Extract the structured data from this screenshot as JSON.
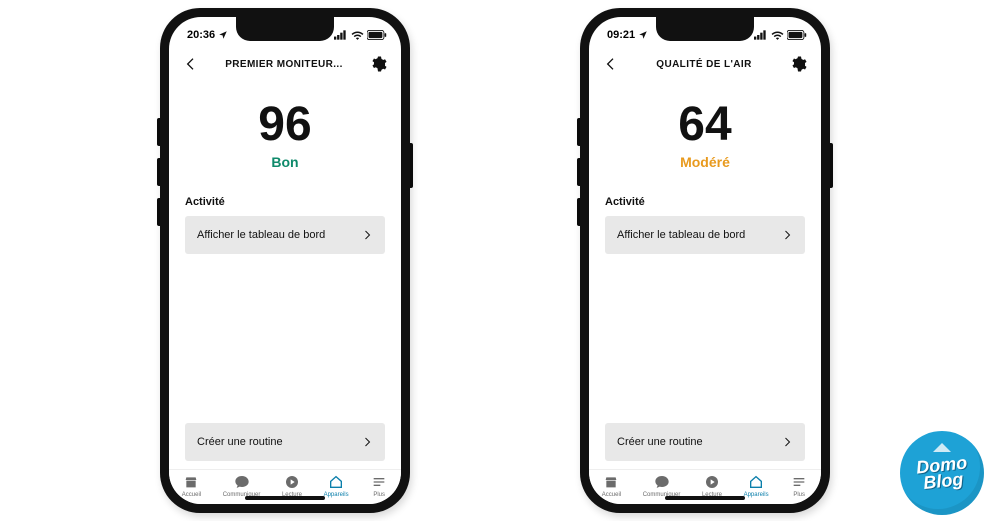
{
  "phones": [
    {
      "status": {
        "time": "20:36"
      },
      "header": {
        "title": "PREMIER MONITEUR..."
      },
      "score": "96",
      "quality": {
        "label": "Bon",
        "class": "q-good"
      },
      "activity_label": "Activité",
      "dashboard_btn": "Afficher le tableau de bord",
      "routine_btn": "Créer une routine"
    },
    {
      "status": {
        "time": "09:21"
      },
      "header": {
        "title": "QUALITÉ DE L'AIR"
      },
      "score": "64",
      "quality": {
        "label": "Modéré",
        "class": "q-mod"
      },
      "activity_label": "Activité",
      "dashboard_btn": "Afficher le tableau de bord",
      "routine_btn": "Créer une routine"
    }
  ],
  "tabs": [
    {
      "label": "Accueil"
    },
    {
      "label": "Communiquer"
    },
    {
      "label": "Lecture"
    },
    {
      "label": "Appareils"
    },
    {
      "label": "Plus"
    }
  ],
  "watermark": {
    "line1": "Domo",
    "line2": "Blog"
  }
}
